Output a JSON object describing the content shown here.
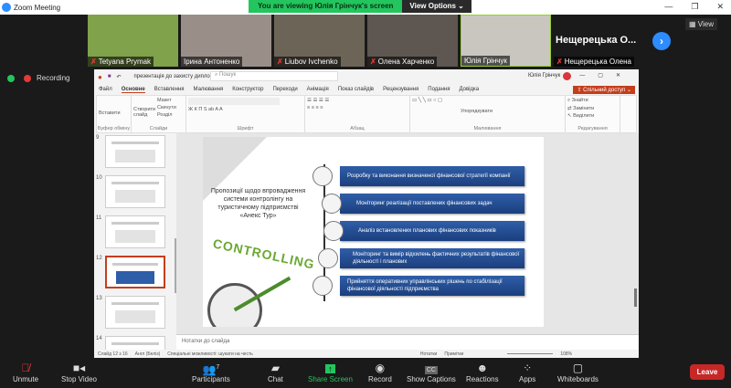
{
  "window": {
    "title": "Zoom Meeting",
    "banner": "You are viewing Юлія Грінчук's screen",
    "view_options": "View Options",
    "view": "View"
  },
  "participants": [
    {
      "name": "Tetyana Prymak",
      "muted": true,
      "bg": "#7fa24a"
    },
    {
      "name": "Ірина Антоненко",
      "muted": false,
      "bg": "#9a8f88"
    },
    {
      "name": "Liubov Ivchenko",
      "muted": true,
      "bg": "#6d6458"
    },
    {
      "name": "Олена Харченко",
      "muted": true,
      "bg": "#5e5650"
    },
    {
      "name": "Юлія Грінчук",
      "muted": false,
      "bg": "#c9c6bf"
    },
    {
      "name": "Нещерецька Олена",
      "muted": true,
      "bg": "#1a1a1a"
    }
  ],
  "overflow_name": "Нещерецька О...",
  "recording": "Recording",
  "ppt": {
    "title": "презентація до захисту диплому Грінчук - PowerPoint",
    "search": "Пошук",
    "user": "Юлія Грінчук",
    "tabs": [
      "Файл",
      "Основне",
      "Вставлення",
      "Малювання",
      "Конструктор",
      "Переходи",
      "Анімація",
      "Показ слайдів",
      "Рецензування",
      "Подання",
      "Довідка"
    ],
    "share": "Спільний доступ",
    "groups": {
      "clipboard": "Буфер обміну",
      "slides": "Слайди",
      "font": "Шрифт",
      "paragraph": "Абзац",
      "drawing": "Малювання",
      "editing": "Редагування"
    },
    "ribbon": {
      "paste": "Вставити",
      "new_slide": "Створити слайд",
      "layout": "Макет",
      "reset": "Скинути",
      "section": "Розділ",
      "arrange": "Упорядкувати",
      "find": "Знайти",
      "replace": "Замінити",
      "select": "Виділити"
    },
    "slide_numbers": [
      "9",
      "10",
      "11",
      "12",
      "13",
      "14"
    ],
    "slide": {
      "title": "Пропозиції щодо впровадження системи контролінгу на туристичному підприємстві «Анекс Тур»",
      "items": [
        "Розробку та виконання визначеної фінансової стратегії компанії",
        "Моніторинг реалізації поставлених фінансових задач",
        "Аналіз встановлених планових фінансових показників",
        "Моніторинг та вимір відхилень фактичних результатів фінансової діяльності і планових",
        "Прийняття оперативних управлінських рішень по стабілізації фінансової діяльності підприємства"
      ],
      "image_text": "CONTROLLING"
    },
    "notes": "Нотатки до слайда",
    "status": {
      "slide": "Слайд 12 з 16",
      "lang": "Англ (Беліз)",
      "accessibility": "Спеціальні можливості: шукати на честь",
      "notes": "Нотатки",
      "comments": "Примітки",
      "zoom": "108%"
    }
  },
  "toolbar": {
    "unmute": "Unmute",
    "video": "Stop Video",
    "participants": "Participants",
    "count": "7",
    "chat": "Chat",
    "share": "Share Screen",
    "record": "Record",
    "captions": "Show Captions",
    "reactions": "Reactions",
    "apps": "Apps",
    "whiteboards": "Whiteboards",
    "leave": "Leave"
  }
}
